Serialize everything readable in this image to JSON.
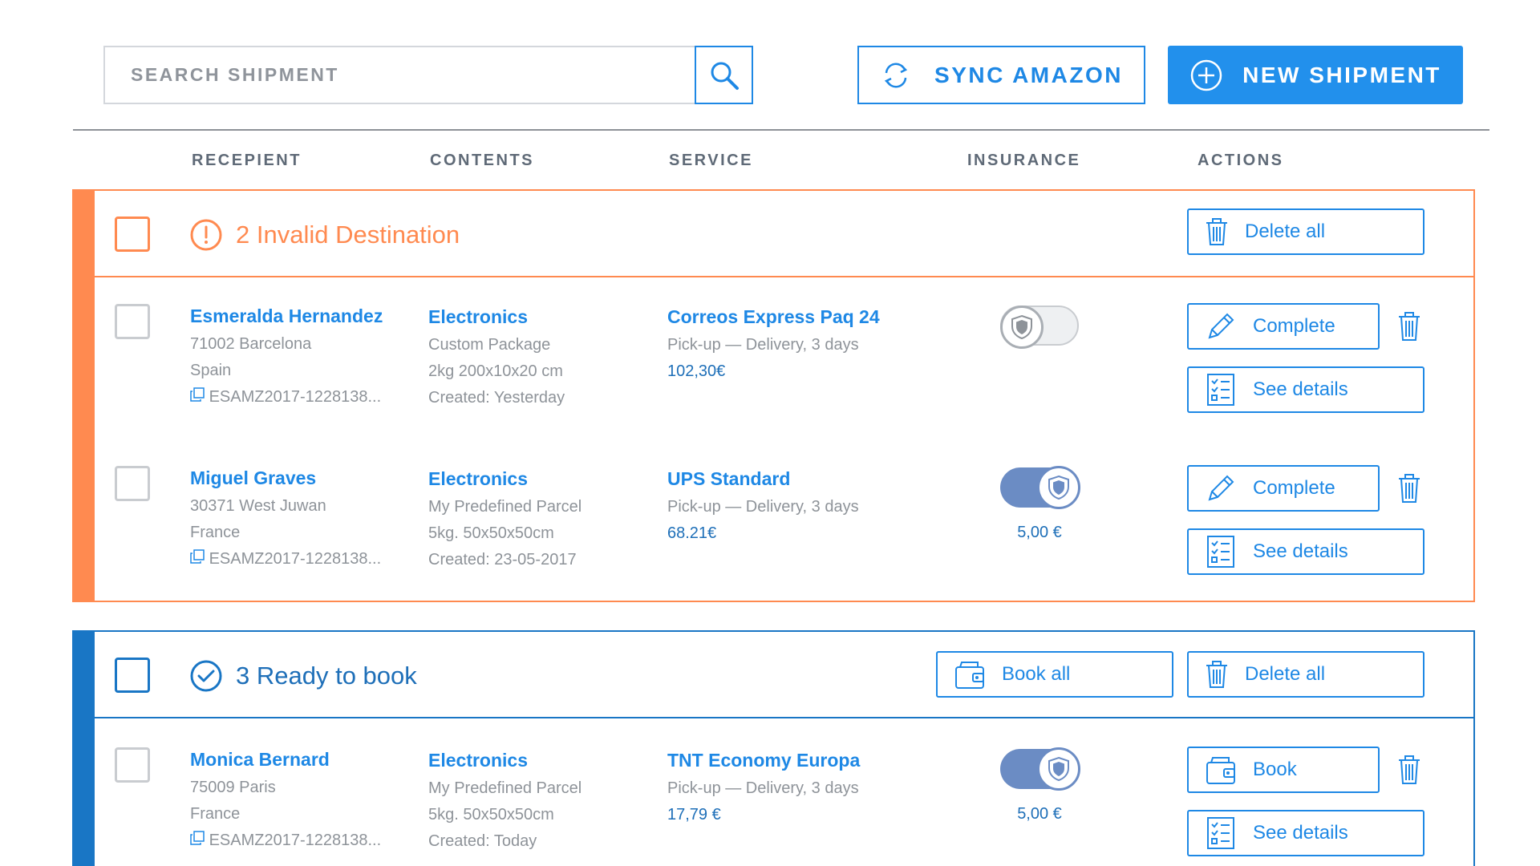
{
  "search": {
    "placeholder": "SEARCH SHIPMENT"
  },
  "toolbar": {
    "sync_label": "SYNC AMAZON",
    "new_label": "NEW SHIPMENT"
  },
  "columns": [
    "RECEPIENT",
    "CONTENTS",
    "SERVICE",
    "INSURANCE",
    "ACTIONS"
  ],
  "groups": {
    "invalid": {
      "title": "2 Invalid Destination",
      "delete_all": "Delete all",
      "rows": [
        {
          "name": "Esmeralda Hernandez",
          "address": "71002  Barcelona",
          "country": "Spain",
          "tracking": "ESAMZ2017-1228138...",
          "contents_title": "Electronics",
          "package": "Custom Package",
          "dims": "2kg 200x10x20 cm",
          "created": "Created: Yesterday",
          "service": "Correos Express Paq 24",
          "delivery": "Pick-up — Delivery, 3 days",
          "price": "102,30€",
          "insured": false,
          "insurance_amount": "",
          "action_label": "Complete",
          "details_label": "See details"
        },
        {
          "name": "Miguel Graves",
          "address": "30371  West Juwan",
          "country": "France",
          "tracking": "ESAMZ2017-1228138...",
          "contents_title": "Electronics",
          "package": "My Predefined Parcel",
          "dims": "5kg. 50x50x50cm",
          "created": "Created: 23-05-2017",
          "service": "UPS Standard",
          "delivery": "Pick-up — Delivery, 3 days",
          "price": "68.21€",
          "insured": true,
          "insurance_amount": "5,00 €",
          "action_label": "Complete",
          "details_label": "See details"
        }
      ]
    },
    "ready": {
      "title": "3 Ready to book",
      "book_all": "Book all",
      "delete_all": "Delete all",
      "rows": [
        {
          "name": "Monica Bernard",
          "address": "75009  Paris",
          "country": "France",
          "tracking": "ESAMZ2017-1228138...",
          "contents_title": "Electronics",
          "package": "My Predefined Parcel",
          "dims": "5kg. 50x50x50cm",
          "created": "Created: Today",
          "service": "TNT Economy Europa",
          "delivery": "Pick-up — Delivery, 3 days",
          "price": "17,79 €",
          "insured": true,
          "insurance_amount": "5,00 €",
          "action_label": "Book",
          "details_label": "See details"
        }
      ]
    }
  },
  "colors": {
    "accent": "#1e88e5",
    "primary_button": "#2290ec",
    "warning": "#ff8a50",
    "ready": "#1976c5",
    "toggle_on": "#6b8cc4"
  },
  "icons": [
    "search-icon",
    "sync-icon",
    "plus-circle-icon",
    "alert-icon",
    "check-circle-icon",
    "trash-icon",
    "pencil-icon",
    "checklist-icon",
    "copy-icon",
    "shield-icon",
    "wallet-icon"
  ]
}
